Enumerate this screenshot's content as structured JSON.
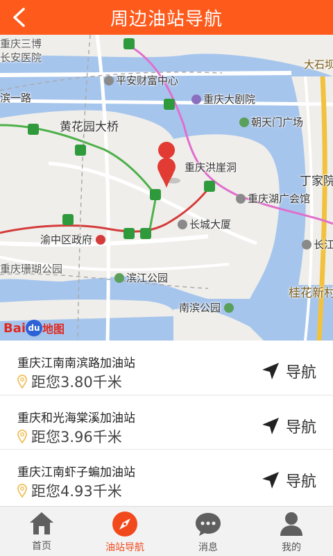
{
  "header": {
    "title": "周边油站导航"
  },
  "map": {
    "labels": {
      "chongqing_sanbo": "重庆三博",
      "changan_hospital": "长安医院",
      "pingan_center": "平安财富中心",
      "dashitou": "大石坝",
      "binyilu": "滨一路",
      "grand_theatre": "重庆大剧院",
      "huangyuan_bridge": "黄花园大桥",
      "chaotianmen": "朝天门广场",
      "hongyadong": "重庆洪崖洞",
      "dingjiayuan": "丁家院",
      "huguang_hall": "重庆湖广会馆",
      "changcheng_mansion": "长城大厦",
      "changjiang": "长江索",
      "yuzhong_gov": "渝中区政府",
      "coral_park": "重庆珊瑚公园",
      "binjiang_park": "滨江公园",
      "guihua": "桂花新村",
      "nanbin_park": "南滨公园"
    },
    "logo": {
      "bai": "Bai",
      "du": "du",
      "ditu": "地图"
    }
  },
  "stations": [
    {
      "name": "重庆江南南滨路加油站",
      "distance": "距您3.80千米",
      "nav_label": "导航"
    },
    {
      "name": "重庆和光海棠溪加油站",
      "distance": "距您3.96千米",
      "nav_label": "导航"
    },
    {
      "name": "重庆江南虾子蝙加油站",
      "distance": "距您4.93千米",
      "nav_label": "导航"
    }
  ],
  "tabs": [
    {
      "label": "首页",
      "icon": "home-icon"
    },
    {
      "label": "油站导航",
      "icon": "compass-icon"
    },
    {
      "label": "消息",
      "icon": "chat-icon"
    },
    {
      "label": "我的",
      "icon": "user-icon"
    }
  ],
  "colors": {
    "accent": "#fe5a1c",
    "river": "#a6c5ed",
    "active_tab": "#f2491c"
  }
}
